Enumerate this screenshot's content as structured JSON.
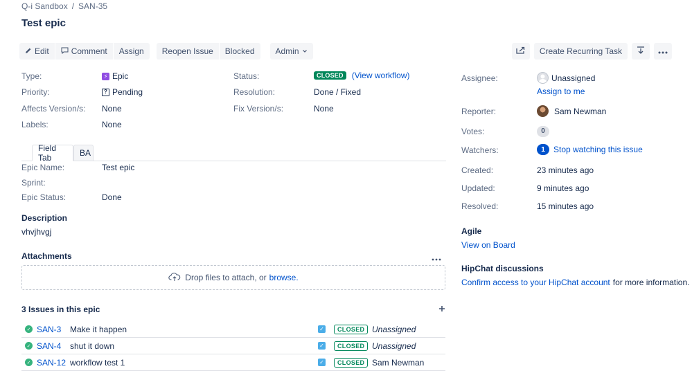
{
  "breadcrumb": {
    "project": "Q-i Sandbox",
    "separator": "/",
    "issue_key": "SAN-35"
  },
  "title": "Test epic",
  "toolbar": {
    "edit": "Edit",
    "comment": "Comment",
    "assign": "Assign",
    "reopen": "Reopen Issue",
    "blocked": "Blocked",
    "admin": "Admin",
    "create_recurring": "Create Recurring Task"
  },
  "details": {
    "type_label": "Type:",
    "type_value": "Epic",
    "priority_label": "Priority:",
    "priority_value": "Pending",
    "affects_label": "Affects Version/s:",
    "affects_value": "None",
    "labels_label": "Labels:",
    "labels_value": "None",
    "status_label": "Status:",
    "status_value": "CLOSED",
    "view_workflow": "(View workflow)",
    "resolution_label": "Resolution:",
    "resolution_value": "Done / Fixed",
    "fix_label": "Fix Version/s:",
    "fix_value": "None"
  },
  "tabs": [
    "Field Tab",
    "BA"
  ],
  "field_tab": {
    "epic_name_label": "Epic Name:",
    "epic_name_value": "Test epic",
    "sprint_label": "Sprint:",
    "epic_status_label": "Epic Status:",
    "epic_status_value": "Done"
  },
  "description": {
    "title": "Description",
    "text": "vhvjhvgj"
  },
  "attachments": {
    "title": "Attachments",
    "drop_text": "Drop files to attach, or",
    "browse": "browse."
  },
  "epic_issues": {
    "title": "3 Issues in this epic",
    "rows": [
      {
        "key": "SAN-3",
        "summary": "Make it happen",
        "status": "CLOSED",
        "assignee": "Unassigned"
      },
      {
        "key": "SAN-4",
        "summary": "shut it down",
        "status": "CLOSED",
        "assignee": "Unassigned"
      },
      {
        "key": "SAN-12",
        "summary": "workflow test 1",
        "status": "CLOSED",
        "assignee": "Sam Newman"
      }
    ]
  },
  "people": {
    "assignee_label": "Assignee:",
    "assignee_value": "Unassigned",
    "assign_to_me": "Assign to me",
    "reporter_label": "Reporter:",
    "reporter_value": "Sam Newman",
    "votes_label": "Votes:",
    "votes_count": "0",
    "watchers_label": "Watchers:",
    "watchers_count": "1",
    "stop_watching": "Stop watching this issue"
  },
  "dates": {
    "created_label": "Created:",
    "created_value": "23 minutes ago",
    "updated_label": "Updated:",
    "updated_value": "9 minutes ago",
    "resolved_label": "Resolved:",
    "resolved_value": "15 minutes ago"
  },
  "agile": {
    "title": "Agile",
    "link": "View on Board"
  },
  "hipchat": {
    "title": "HipChat discussions",
    "link": "Confirm access to your HipChat account",
    "suffix": "for more information."
  },
  "colors": {
    "link": "#0052cc",
    "closed_green": "#00875a",
    "epic_purple": "#904ee2",
    "button_bg": "#f4f5f7"
  }
}
